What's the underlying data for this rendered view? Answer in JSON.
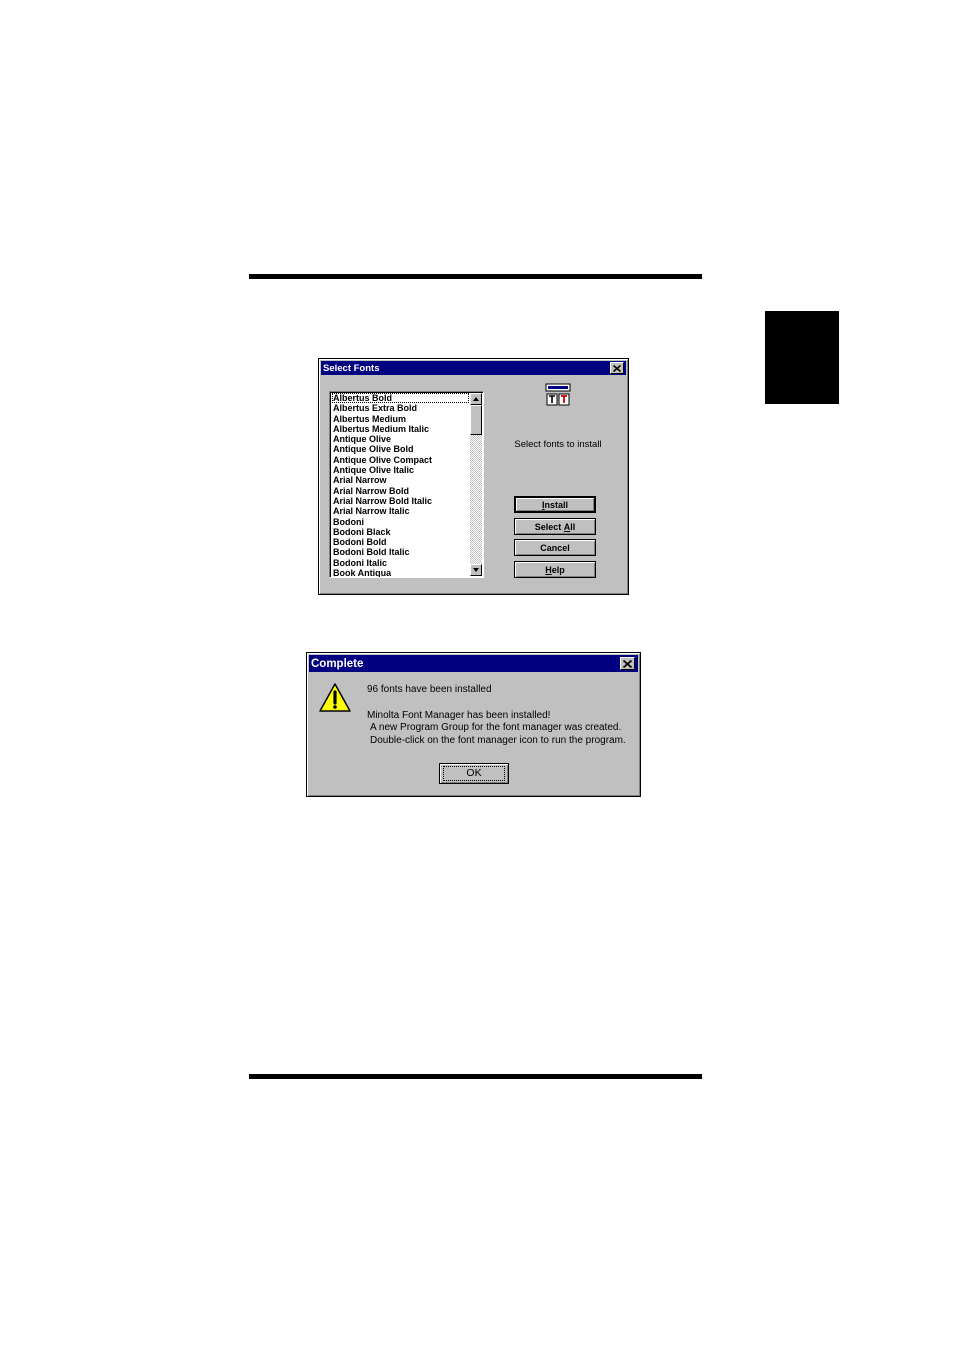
{
  "select_fonts_dialog": {
    "title": "Select Fonts",
    "fonts": [
      "Albertus Bold",
      "Albertus Extra Bold",
      "Albertus Medium",
      "Albertus Medium Italic",
      "Antique Olive",
      "Antique Olive Bold",
      "Antique Olive Compact",
      "Antique Olive Italic",
      "Arial Narrow",
      "Arial Narrow Bold",
      "Arial Narrow Bold Italic",
      "Arial Narrow Italic",
      "Bodoni",
      "Bodoni Black",
      "Bodoni Bold",
      "Bodoni Bold Italic",
      "Bodoni Italic",
      "Book Antiqua"
    ],
    "prompt": "Select fonts to install",
    "buttons": {
      "install": {
        "label": "Install",
        "mnemonic": "I",
        "rest": "nstall"
      },
      "select_all": {
        "label": "Select All",
        "before": "Select ",
        "mnemonic": "A",
        "rest": "ll"
      },
      "cancel": {
        "label": "Cancel"
      },
      "help": {
        "label": "Help",
        "mnemonic": "H",
        "rest": "elp"
      }
    },
    "icons": [
      "scroll-up-arrow-icon",
      "scroll-down-arrow-icon",
      "close-icon",
      "font-manager-icon"
    ]
  },
  "complete_dialog": {
    "title": "Complete",
    "line1": "96 fonts have been installed",
    "line2": "Minolta Font Manager has been installed!",
    "line3": "A new Program Group for the font manager was created.",
    "line4": "Double-click on the font manager icon to run the program.",
    "ok_label": "OK",
    "icons": [
      "warning-icon",
      "close-icon"
    ]
  },
  "colors": {
    "titlebar": "#000080",
    "dialog_face": "#c0c0c0",
    "warning_yellow": "#ffff00"
  }
}
